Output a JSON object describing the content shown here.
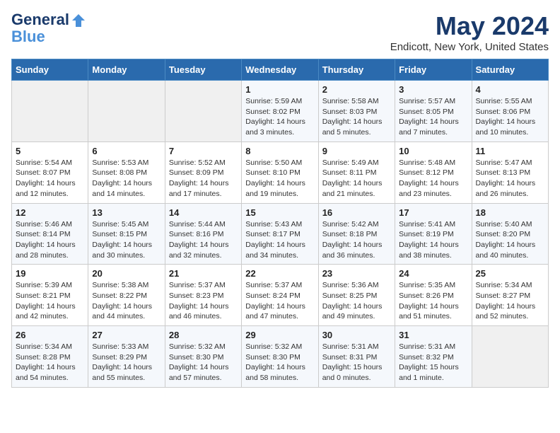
{
  "header": {
    "logo_line1": "General",
    "logo_line2": "Blue",
    "title": "May 2024",
    "subtitle": "Endicott, New York, United States"
  },
  "days_of_week": [
    "Sunday",
    "Monday",
    "Tuesday",
    "Wednesday",
    "Thursday",
    "Friday",
    "Saturday"
  ],
  "weeks": [
    [
      {
        "num": "",
        "info": "",
        "empty": true
      },
      {
        "num": "",
        "info": "",
        "empty": true
      },
      {
        "num": "",
        "info": "",
        "empty": true
      },
      {
        "num": "1",
        "info": "Sunrise: 5:59 AM\nSunset: 8:02 PM\nDaylight: 14 hours\nand 3 minutes."
      },
      {
        "num": "2",
        "info": "Sunrise: 5:58 AM\nSunset: 8:03 PM\nDaylight: 14 hours\nand 5 minutes."
      },
      {
        "num": "3",
        "info": "Sunrise: 5:57 AM\nSunset: 8:05 PM\nDaylight: 14 hours\nand 7 minutes."
      },
      {
        "num": "4",
        "info": "Sunrise: 5:55 AM\nSunset: 8:06 PM\nDaylight: 14 hours\nand 10 minutes."
      }
    ],
    [
      {
        "num": "5",
        "info": "Sunrise: 5:54 AM\nSunset: 8:07 PM\nDaylight: 14 hours\nand 12 minutes."
      },
      {
        "num": "6",
        "info": "Sunrise: 5:53 AM\nSunset: 8:08 PM\nDaylight: 14 hours\nand 14 minutes."
      },
      {
        "num": "7",
        "info": "Sunrise: 5:52 AM\nSunset: 8:09 PM\nDaylight: 14 hours\nand 17 minutes."
      },
      {
        "num": "8",
        "info": "Sunrise: 5:50 AM\nSunset: 8:10 PM\nDaylight: 14 hours\nand 19 minutes."
      },
      {
        "num": "9",
        "info": "Sunrise: 5:49 AM\nSunset: 8:11 PM\nDaylight: 14 hours\nand 21 minutes."
      },
      {
        "num": "10",
        "info": "Sunrise: 5:48 AM\nSunset: 8:12 PM\nDaylight: 14 hours\nand 23 minutes."
      },
      {
        "num": "11",
        "info": "Sunrise: 5:47 AM\nSunset: 8:13 PM\nDaylight: 14 hours\nand 26 minutes."
      }
    ],
    [
      {
        "num": "12",
        "info": "Sunrise: 5:46 AM\nSunset: 8:14 PM\nDaylight: 14 hours\nand 28 minutes."
      },
      {
        "num": "13",
        "info": "Sunrise: 5:45 AM\nSunset: 8:15 PM\nDaylight: 14 hours\nand 30 minutes."
      },
      {
        "num": "14",
        "info": "Sunrise: 5:44 AM\nSunset: 8:16 PM\nDaylight: 14 hours\nand 32 minutes."
      },
      {
        "num": "15",
        "info": "Sunrise: 5:43 AM\nSunset: 8:17 PM\nDaylight: 14 hours\nand 34 minutes."
      },
      {
        "num": "16",
        "info": "Sunrise: 5:42 AM\nSunset: 8:18 PM\nDaylight: 14 hours\nand 36 minutes."
      },
      {
        "num": "17",
        "info": "Sunrise: 5:41 AM\nSunset: 8:19 PM\nDaylight: 14 hours\nand 38 minutes."
      },
      {
        "num": "18",
        "info": "Sunrise: 5:40 AM\nSunset: 8:20 PM\nDaylight: 14 hours\nand 40 minutes."
      }
    ],
    [
      {
        "num": "19",
        "info": "Sunrise: 5:39 AM\nSunset: 8:21 PM\nDaylight: 14 hours\nand 42 minutes."
      },
      {
        "num": "20",
        "info": "Sunrise: 5:38 AM\nSunset: 8:22 PM\nDaylight: 14 hours\nand 44 minutes."
      },
      {
        "num": "21",
        "info": "Sunrise: 5:37 AM\nSunset: 8:23 PM\nDaylight: 14 hours\nand 46 minutes."
      },
      {
        "num": "22",
        "info": "Sunrise: 5:37 AM\nSunset: 8:24 PM\nDaylight: 14 hours\nand 47 minutes."
      },
      {
        "num": "23",
        "info": "Sunrise: 5:36 AM\nSunset: 8:25 PM\nDaylight: 14 hours\nand 49 minutes."
      },
      {
        "num": "24",
        "info": "Sunrise: 5:35 AM\nSunset: 8:26 PM\nDaylight: 14 hours\nand 51 minutes."
      },
      {
        "num": "25",
        "info": "Sunrise: 5:34 AM\nSunset: 8:27 PM\nDaylight: 14 hours\nand 52 minutes."
      }
    ],
    [
      {
        "num": "26",
        "info": "Sunrise: 5:34 AM\nSunset: 8:28 PM\nDaylight: 14 hours\nand 54 minutes."
      },
      {
        "num": "27",
        "info": "Sunrise: 5:33 AM\nSunset: 8:29 PM\nDaylight: 14 hours\nand 55 minutes."
      },
      {
        "num": "28",
        "info": "Sunrise: 5:32 AM\nSunset: 8:30 PM\nDaylight: 14 hours\nand 57 minutes."
      },
      {
        "num": "29",
        "info": "Sunrise: 5:32 AM\nSunset: 8:30 PM\nDaylight: 14 hours\nand 58 minutes."
      },
      {
        "num": "30",
        "info": "Sunrise: 5:31 AM\nSunset: 8:31 PM\nDaylight: 15 hours\nand 0 minutes."
      },
      {
        "num": "31",
        "info": "Sunrise: 5:31 AM\nSunset: 8:32 PM\nDaylight: 15 hours\nand 1 minute."
      },
      {
        "num": "",
        "info": "",
        "empty": true
      }
    ]
  ]
}
